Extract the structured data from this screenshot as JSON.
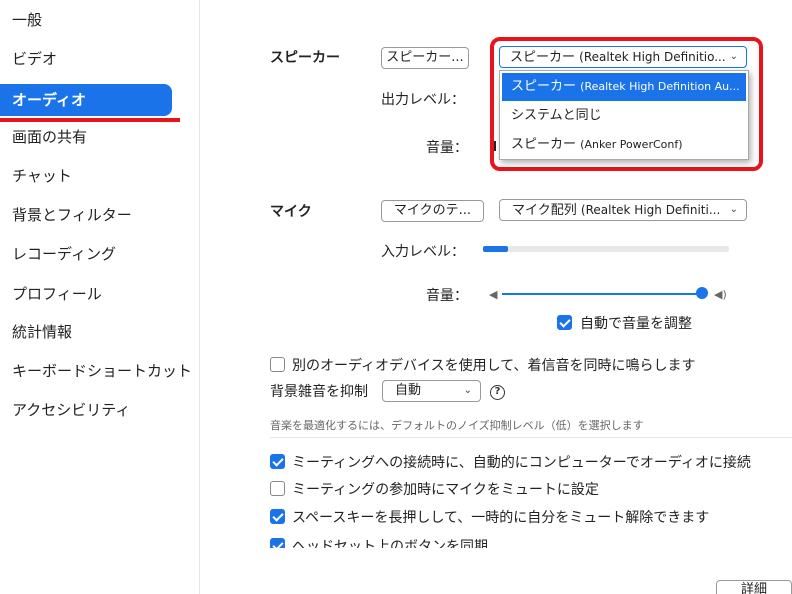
{
  "sidebar": {
    "items": [
      {
        "label": "一般"
      },
      {
        "label": "ビデオ"
      },
      {
        "label": "オーディオ",
        "active": true
      },
      {
        "label": "画面の共有"
      },
      {
        "label": "チャット"
      },
      {
        "label": "背景とフィルター"
      },
      {
        "label": "レコーディング"
      },
      {
        "label": "プロフィール"
      },
      {
        "label": "統計情報"
      },
      {
        "label": "キーボードショートカット"
      },
      {
        "label": "アクセシビリティ"
      }
    ]
  },
  "speaker": {
    "section_label": "スピーカー",
    "test_button": "スピーカー...",
    "device_main": "スピーカー",
    "device_sub": "(Realtek High Definitio...",
    "output_level_label": "出力レベル：",
    "volume_label": "音量：",
    "dropdown_options": [
      {
        "main": "スピーカー",
        "sub": "(Realtek High Definition Au...",
        "selected": true
      },
      {
        "main": "システムと同じ",
        "sub": ""
      },
      {
        "main": "スピーカー",
        "sub": "(Anker PowerConf)"
      }
    ]
  },
  "mic": {
    "section_label": "マイク",
    "test_button": "マイクのテ...",
    "device_main": "マイク配列",
    "device_sub": "(Realtek High Definiti...",
    "input_level_label": "入力レベル：",
    "input_level": 0.1,
    "volume_label": "音量：",
    "volume": 1.0,
    "auto_adjust_label": "自動で音量を調整",
    "auto_adjust_checked": true
  },
  "options": {
    "separate_device_label": "別のオーディオデバイスを使用して、着信音を同時に鳴らします",
    "separate_device_checked": false,
    "noise_label": "背景雑音を抑制",
    "noise_value": "自動",
    "noise_note": "音楽を最適化するには、デフォルトのノイズ抑制レベル（低）を選択します",
    "auto_join_label": "ミーティングへの接続時に、自動的にコンピューターでオーディオに接続",
    "auto_join_checked": true,
    "mute_on_join_label": "ミーティングの参加時にマイクをミュートに設定",
    "mute_on_join_checked": false,
    "space_unmute_label": "スペースキーを長押しして、一時的に自分をミュート解除できます",
    "space_unmute_checked": true,
    "headset_label": "ヘッドセット上のボタンを同期"
  },
  "details_button": "詳細",
  "colors": {
    "accent": "#1a73e8",
    "highlight": "#e8131b"
  }
}
